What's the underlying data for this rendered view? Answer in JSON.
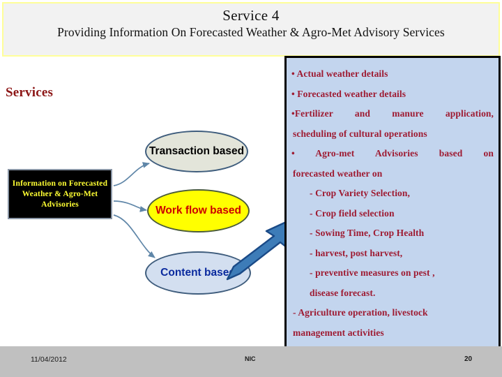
{
  "slide": {
    "title": {
      "line1": "Service 4",
      "line2": "Providing Information On Forecasted Weather & Agro-Met Advisory Services"
    },
    "left": {
      "section_label": "Services",
      "source_box_text": "Information on Forecasted Weather & Agro-Met Advisories",
      "nodes": [
        {
          "id": "transaction",
          "label": "Transaction based",
          "fill": "#e3e5da",
          "text_color": "#000000"
        },
        {
          "id": "workflow",
          "label": "Work flow based",
          "fill": "#ffff00",
          "text_color": "#cc0000"
        },
        {
          "id": "content",
          "label": "Content based",
          "fill": "#d3dff0",
          "text_color": "#0a2a9e"
        }
      ]
    },
    "right_panel": {
      "background": "#c3d5ee",
      "text_color": "#9e1b32",
      "lines": [
        "• Actual weather details",
        "• Forecasted weather details",
        "•Fertilizer and manure application,",
        "scheduling of cultural operations",
        "•  Agro-met  Advisories  based  on",
        "forecasted weather on",
        "- Crop Variety Selection,",
        "- Crop field selection",
        "-  Sowing Time, Crop Health",
        "-  harvest, post harvest,",
        "-  preventive measures on pest ,",
        "disease forecast.",
        "- Agriculture operation, livestock",
        "management activities"
      ]
    },
    "footer": {
      "date": "11/04/2012",
      "center": "NIC",
      "page_number": "20"
    }
  }
}
